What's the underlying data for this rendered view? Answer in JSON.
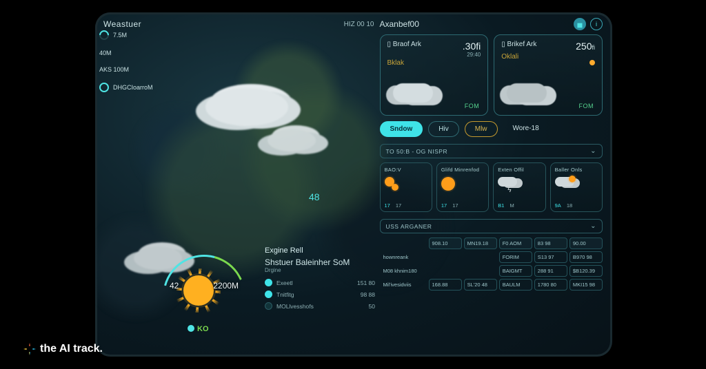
{
  "colors": {
    "accent": "#3fe3e8",
    "accent2": "#4fe4e4",
    "warn": "#c59a2e",
    "ok": "#55d28e"
  },
  "header": {
    "title": "Weastuer",
    "hz": "HIZ 00 10"
  },
  "gauges": [
    {
      "label": "7.5M"
    },
    {
      "label": "40M"
    },
    {
      "label": "AKS 100M"
    },
    {
      "label": "DHGCIoarroM"
    }
  ],
  "map": {
    "center_value": "48"
  },
  "sun_widget": {
    "left": "42",
    "right": "2200M",
    "ko": "KO"
  },
  "engine": {
    "title": "Exgine Rell",
    "subtitle": "Shstuer Baleinher SoM",
    "subtitle2": "Drgine",
    "rows": [
      {
        "dot": "#3fe3e8",
        "label": "Exeetl",
        "value": "151 80"
      },
      {
        "dot": "#3fe3e8",
        "label": "Tnitfitg",
        "value": "98 88"
      },
      {
        "dot": "#12343a",
        "label": "MOLlvesshofs",
        "value": "50"
      }
    ]
  },
  "right_header": {
    "title": "Axanbef00"
  },
  "weather_cards": [
    {
      "title": "Braof Ark",
      "value": ".30fi",
      "small": "29:40",
      "sub": "Bklak",
      "badge": "FOM"
    },
    {
      "title": "Brikef Ark",
      "value": "250",
      "unit": "fi",
      "sub": "Oklali",
      "badge": "FOM"
    }
  ],
  "tabs": [
    {
      "label": "Sndow",
      "active": true
    },
    {
      "label": "Hiv"
    },
    {
      "label": "Mlw",
      "variant": "mw"
    },
    {
      "label": "Wore-18",
      "variant": "plain"
    }
  ],
  "section1": {
    "label": "TO 50:B - OG NISPR"
  },
  "forecast": [
    {
      "title": "BAO:V",
      "lo": "17",
      "hi": "17",
      "icon": "sun-multi"
    },
    {
      "title": "Glifd Minrenfod",
      "lo": "17",
      "hi": "17",
      "icon": "sun"
    },
    {
      "title": "Exten Offil",
      "lo": "B1",
      "hi": "M",
      "icon": "cloud-bolt"
    },
    {
      "title": "Baller Onls",
      "lo": "9A",
      "hi": "18",
      "icon": "cloud-sun"
    }
  ],
  "section2": {
    "label": "USS ARGANER"
  },
  "table": {
    "col_headers": [
      "908.10",
      "MN19.18",
      "F0 AOM",
      "83 98",
      "90.00"
    ],
    "rows": [
      {
        "label": "hownreank",
        "cells": [
          "",
          "",
          "FORIM",
          "S13 97",
          "B970 98"
        ]
      },
      {
        "label": "M08 khnim180",
        "cells": [
          "",
          "",
          "BAIGMT",
          "288 91",
          "$B120.39"
        ]
      },
      {
        "label": "Mil'ivesidviis",
        "cells": [
          "168.88",
          "SL'20 48",
          "BAULM",
          "1780 80",
          "MKI15 98"
        ]
      }
    ]
  },
  "watermark": "the AI track."
}
